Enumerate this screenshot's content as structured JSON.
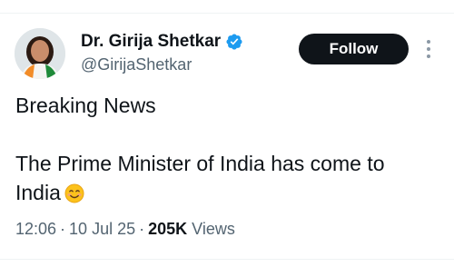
{
  "author": {
    "display_name": "Dr. Girija Shetkar",
    "handle": "@GirijaShetkar",
    "verified": true
  },
  "actions": {
    "follow_label": "Follow"
  },
  "tweet": {
    "line1": "Breaking News",
    "line2": "The Prime Minister of India has come to",
    "line3": "India",
    "emoji": "smiling-face-icon"
  },
  "meta": {
    "time": "12:06",
    "separator": "·",
    "date": "10 Jul 25",
    "views_count": "205K",
    "views_label": "Views"
  },
  "colors": {
    "verified_blue": "#1d9bf0",
    "follow_bg": "#0f1419",
    "secondary_text": "#536471"
  }
}
